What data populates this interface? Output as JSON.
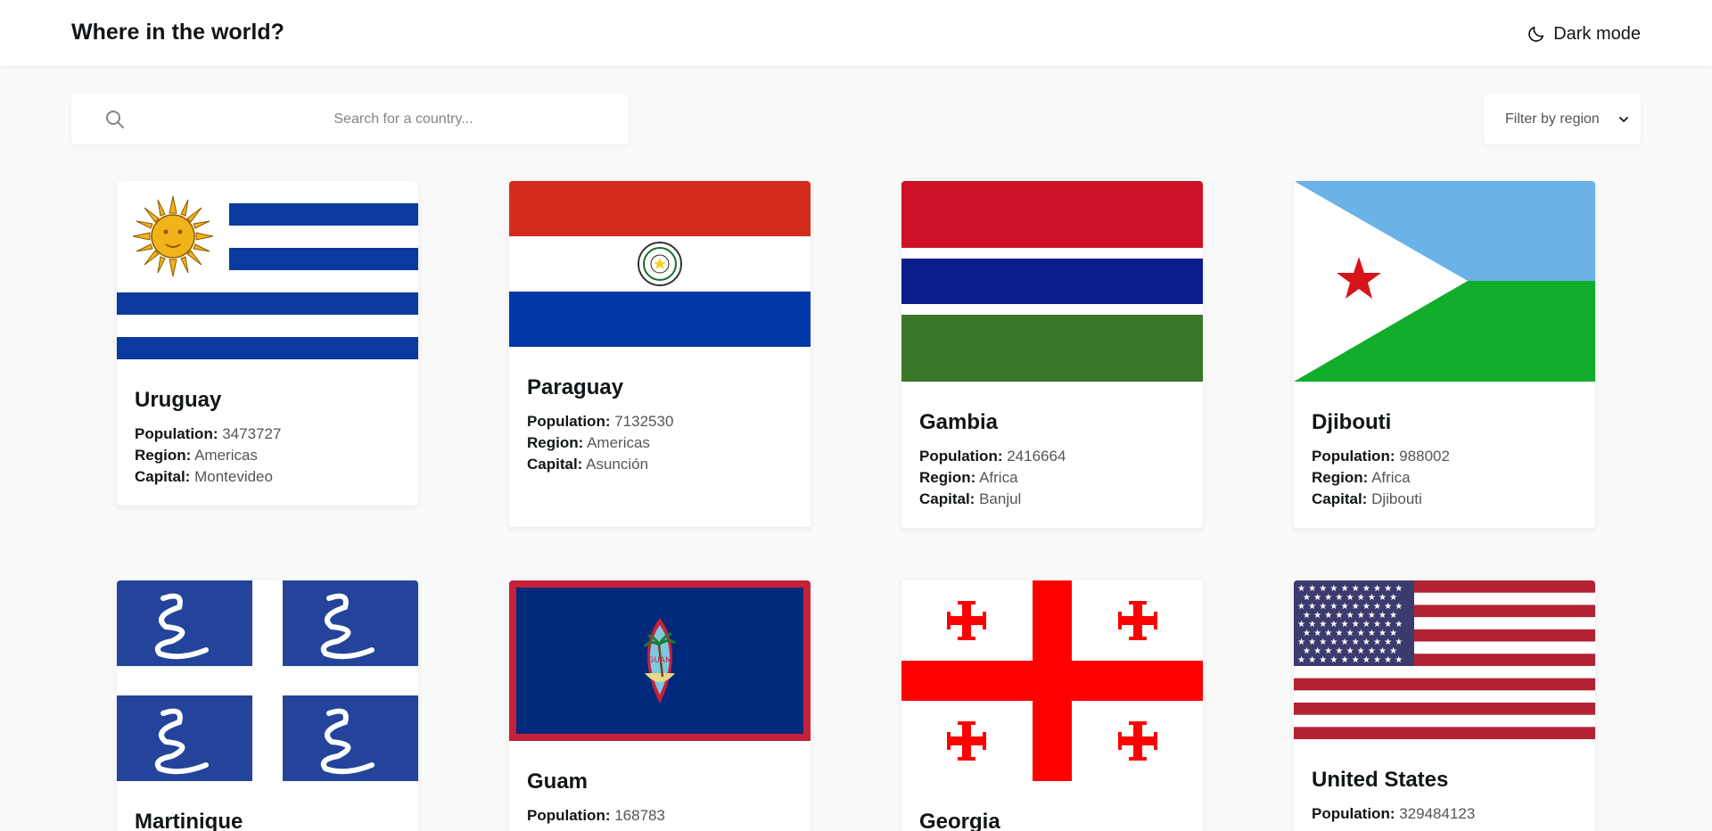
{
  "header": {
    "title": "Where in the world?",
    "dark_mode_label": "Dark mode"
  },
  "search": {
    "placeholder": "Search for a country...",
    "value": ""
  },
  "filter": {
    "label": "Filter by region"
  },
  "labels": {
    "population": "Population:",
    "region": "Region:",
    "capital": "Capital:"
  },
  "countries": [
    {
      "name": "Uruguay",
      "population": "3473727",
      "region": "Americas",
      "capital": "Montevideo"
    },
    {
      "name": "Paraguay",
      "population": "7132530",
      "region": "Americas",
      "capital": "Asunción"
    },
    {
      "name": "Gambia",
      "population": "2416664",
      "region": "Africa",
      "capital": "Banjul"
    },
    {
      "name": "Djibouti",
      "population": "988002",
      "region": "Africa",
      "capital": "Djibouti"
    },
    {
      "name": "Martinique"
    },
    {
      "name": "Guam",
      "population": "168783"
    },
    {
      "name": "Georgia"
    },
    {
      "name": "United States",
      "population": "329484123"
    }
  ],
  "colors": {
    "background": "#fafafa",
    "surface": "#ffffff",
    "text": "#111517",
    "muted": "#555555"
  }
}
